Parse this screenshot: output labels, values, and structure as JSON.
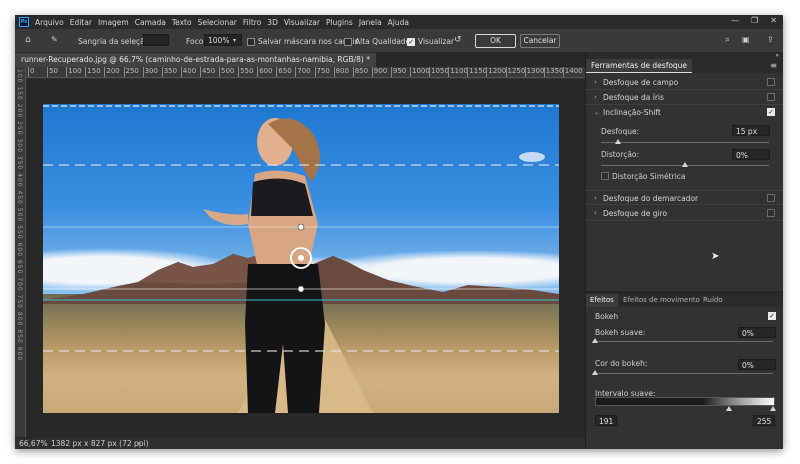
{
  "app": {
    "logo": "Ps",
    "menu": [
      "Arquivo",
      "Editar",
      "Imagem",
      "Camada",
      "Texto",
      "Selecionar",
      "Filtro",
      "3D",
      "Visualizar",
      "Plugins",
      "Janela",
      "Ajuda"
    ],
    "window_controls": [
      "—",
      "❐",
      "✕"
    ]
  },
  "options_bar": {
    "feather_label": "Sangria da seleção:",
    "feather_value": "",
    "focus_label": "Foco:",
    "focus_value": "100%",
    "save_mask_label": "Salvar máscara nos canais",
    "save_mask_checked": false,
    "high_quality_label": "Alta Qualidade",
    "high_quality_checked": false,
    "preview_label": "Visualizar",
    "preview_checked": true,
    "ok_label": "OK",
    "cancel_label": "Cancelar",
    "icons": [
      "home-icon",
      "blur-tool-icon",
      "reset-icon",
      "search-icon",
      "workspace-icon",
      "share-icon"
    ]
  },
  "document": {
    "tab_title": "runner-Recuperado.jpg @ 66,7% (caminho-de-estrada-para-as-montanhas-namibia, RGB/8) *",
    "ruler_ticks": [
      "0",
      "50",
      "100",
      "150",
      "200",
      "250",
      "300",
      "350",
      "400",
      "450",
      "500",
      "550",
      "600",
      "650",
      "700",
      "750",
      "800",
      "850",
      "900",
      "950",
      "1000",
      "1050",
      "1100",
      "1150",
      "1200",
      "1250",
      "1300",
      "1350",
      "1400"
    ],
    "ruler_left_text": "100 150 200 250 300 350 400 450 500 550 600 650 700 750 800 850 900"
  },
  "status_bar": {
    "zoom": "66,67%",
    "dimensions": "1382 px x 827 px (72 ppi)",
    "arrow": "›"
  },
  "blur_tools_panel": {
    "title": "Ferramentas de desfoque",
    "items": [
      {
        "label": "Desfoque de campo",
        "expanded": false,
        "checked": false
      },
      {
        "label": "Desfoque da íris",
        "expanded": false,
        "checked": false
      },
      {
        "label": "Inclinação-Shift",
        "expanded": true,
        "checked": true
      },
      {
        "label": "Desfoque do demarcador",
        "expanded": false,
        "checked": false
      },
      {
        "label": "Desfoque de giro",
        "expanded": false,
        "checked": false
      }
    ],
    "tilt_shift": {
      "blur_label": "Desfoque:",
      "blur_value": "15 px",
      "blur_level": 0.1,
      "distortion_label": "Distorção:",
      "distortion_value": "0%",
      "distortion_level": 0.5,
      "symmetric_label": "Distorção Simétrica",
      "symmetric_checked": false
    }
  },
  "effects_panel": {
    "tabs": [
      "Efeitos",
      "Efeitos de movimento",
      "Ruído"
    ],
    "bokeh_label": "Bokeh",
    "bokeh_checked": true,
    "light_bokeh_label": "Bokeh suave:",
    "light_bokeh_value": "0%",
    "bokeh_color_label": "Cor do bokeh:",
    "bokeh_color_value": "0%",
    "light_range_label": "Intervalo suave:",
    "light_range_min": "191",
    "light_range_max": "255"
  },
  "colors": {
    "accent_line": "#2ec4c9",
    "app_bg": "#323232"
  }
}
